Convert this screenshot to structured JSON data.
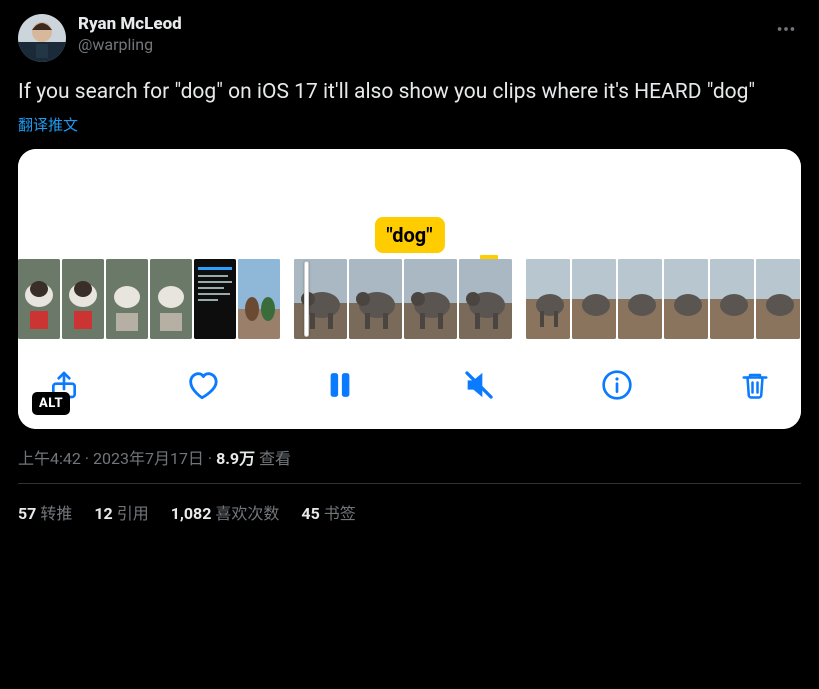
{
  "author": {
    "display_name": "Ryan McLeod",
    "handle": "@warpling"
  },
  "tweet_text": "If you search for \"dog\" on iOS 17 it'll also show you clips where it's HEARD \"dog\"",
  "translate_label": "翻译推文",
  "media": {
    "search_tag": "\"dog\"",
    "alt_badge": "ALT"
  },
  "timestamp": {
    "time": "上午4:42",
    "date": "2023年7月17日"
  },
  "views": {
    "count": "8.9万",
    "label": "查看"
  },
  "counts": {
    "retweets": {
      "n": "57",
      "label": "转推"
    },
    "quotes": {
      "n": "12",
      "label": "引用"
    },
    "likes": {
      "n": "1,082",
      "label": "喜欢次数"
    },
    "bookmarks": {
      "n": "45",
      "label": "书签"
    }
  },
  "icons": {
    "more": "more-icon",
    "share": "share-icon",
    "heart": "heart-icon",
    "pause": "pause-icon",
    "mute": "mute-icon",
    "info": "info-icon",
    "trash": "trash-icon"
  }
}
